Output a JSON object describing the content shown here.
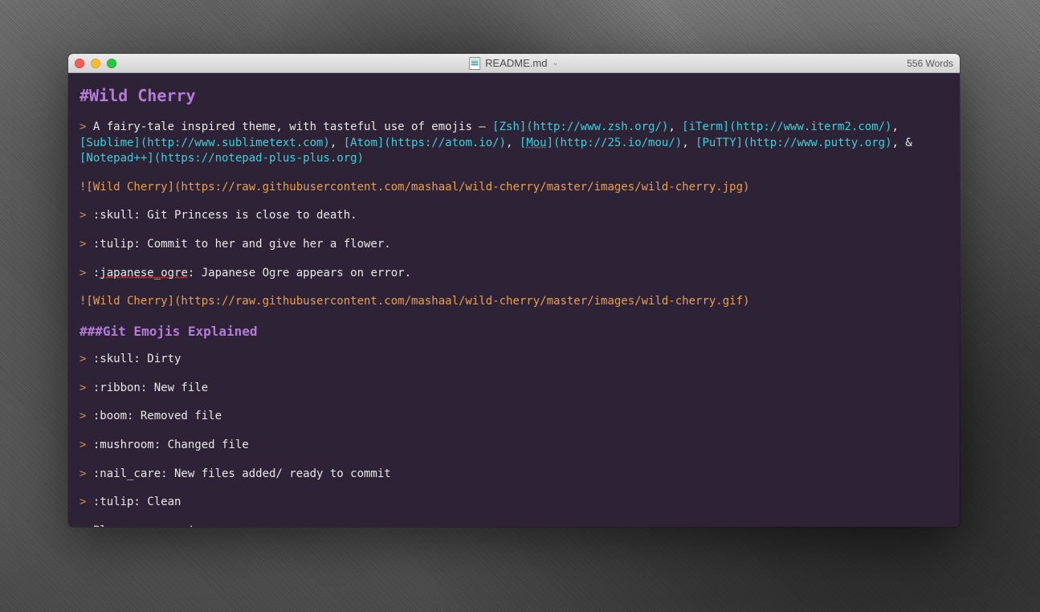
{
  "titlebar": {
    "filename": "README.md",
    "word_count": "556 Words"
  },
  "content": {
    "h1": "#Wild Cherry",
    "intro_prefix": "A fairy-tale inspired theme, with tasteful use of emojis – ",
    "links": {
      "zsh": "[Zsh](http://www.zsh.org/)",
      "iterm": "[iTerm](http://www.iterm2.com/)",
      "sublime": "[Sublime](http://www.sublimetext.com)",
      "atom": "[Atom](https://atom.io/)",
      "mou_label": "Mou",
      "mou_url": "](http://25.io/mou/)",
      "putty": "[PuTTY](http://www.putty.org)",
      "notepad": "[Notepad++](https://notepad-plus-plus.org)"
    },
    "img1": "![Wild Cherry](https://raw.githubusercontent.com/mashaal/wild-cherry/master/images/wild-cherry.jpg)",
    "q1": ":skull: Git Princess is close to death.",
    "q2": ":tulip: Commit to her and give her a flower.",
    "q3_pre": ":",
    "q3_ogre": "japanese_ogre",
    "q3_post": ": Japanese Ogre appears on error.",
    "img2": "![Wild Cherry](https://raw.githubusercontent.com/mashaal/wild-cherry/master/images/wild-cherry.gif)",
    "h3": "###Git Emojis Explained",
    "e1": ":skull: Dirty",
    "e2": ":ribbon: New file",
    "e3": ":boom: Removed file",
    "e4": ":mushroom: Changed file",
    "e5": ":nail_care: New files added/ ready to commit",
    "e6": ":tulip: Clean",
    "e7": "Plus many more!"
  }
}
